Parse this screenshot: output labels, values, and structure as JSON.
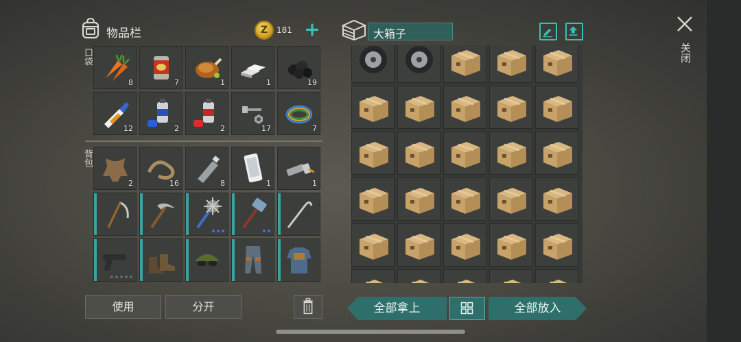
{
  "header": {
    "inventory_title": "物品栏",
    "coin_symbol": "Z",
    "coin_count": "181",
    "plus_symbol": "+",
    "box_name": "大箱子",
    "close_label": "关闭"
  },
  "side_labels": {
    "pockets": "口袋",
    "backpack": "背包"
  },
  "pockets": [
    {
      "icon": "carrot-icon",
      "qty": "8"
    },
    {
      "icon": "canned-food-icon",
      "qty": "7"
    },
    {
      "icon": "roast-chicken-icon",
      "qty": "1"
    },
    {
      "icon": "iron-bars-icon",
      "qty": "1"
    },
    {
      "icon": "coal-icon",
      "qty": "19"
    },
    {
      "icon": "glue-icon",
      "qty": "12"
    },
    {
      "icon": "blue-spray-paint-icon",
      "qty": "2"
    },
    {
      "icon": "red-spray-paint-icon",
      "qty": "2"
    },
    {
      "icon": "bolt-nut-icon",
      "qty": "17"
    },
    {
      "icon": "wire-coil-icon",
      "qty": "7"
    }
  ],
  "backpack": [
    {
      "icon": "leather-hide-icon",
      "qty": "2"
    },
    {
      "icon": "rope-icon",
      "qty": "16"
    },
    {
      "icon": "plastic-bottle-icon",
      "qty": "8"
    },
    {
      "icon": "smartphone-icon",
      "qty": "1"
    },
    {
      "icon": "flashlight-icon",
      "qty": "1"
    },
    {
      "icon": "scythe-icon",
      "qty": ""
    },
    {
      "icon": "pickaxe-icon",
      "qty": ""
    },
    {
      "icon": "spiked-mace-icon",
      "qty": ""
    },
    {
      "icon": "sledgehammer-icon",
      "qty": ""
    },
    {
      "icon": "crowbar-hook-icon",
      "qty": ""
    },
    {
      "icon": "pistol-icon",
      "qty": ""
    },
    {
      "icon": "boots-icon",
      "qty": ""
    },
    {
      "icon": "sunglasses-cap-icon",
      "qty": ""
    },
    {
      "icon": "armored-pants-icon",
      "qty": ""
    },
    {
      "icon": "armored-vest-icon",
      "qty": ""
    }
  ],
  "box_items": [
    "tire-icon",
    "tire-icon",
    "cardboard-box-icon",
    "cardboard-box-icon",
    "cardboard-box-icon"
  ],
  "buttons": {
    "use": "使用",
    "split": "分开",
    "take_all": "全部拿上",
    "put_all": "全部放入"
  },
  "colors": {
    "accent_teal": "#39c0b3",
    "durability_bar": "#3aa2a3",
    "box_name_bg": "#2f5e5b",
    "button_teal": "#2e6f6b"
  }
}
